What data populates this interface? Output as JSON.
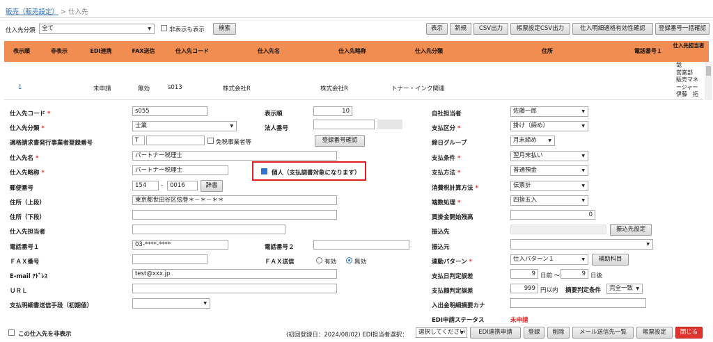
{
  "breadcrumb": {
    "link": "販売（販売設定）",
    "sep": " > ",
    "current": "仕入先"
  },
  "filter": {
    "label": "仕入先分類",
    "value": "全て",
    "show_hidden": "非表示も表示",
    "search": "検索"
  },
  "toolbar": {
    "show": "表示",
    "new": "新規",
    "csv": "CSV出力",
    "form_csv": "帳票設定CSV出力",
    "validity": "仕入明細適格有効性確認",
    "regcheck": "登録番号一括確認"
  },
  "columns": [
    "表示順",
    "非表示",
    "EDI連携",
    "FAX送信",
    "仕入先コード",
    "仕入先名",
    "仕入先略称",
    "仕入先分類",
    "住所",
    "電話番号１",
    "仕入先担当者"
  ],
  "row": {
    "order": "1",
    "edi": "未申請",
    "fax": "無効",
    "code": "s013",
    "name": "株式会社R",
    "short": "株式会社R",
    "cat": "トナー・インク関連",
    "staff": "哉\n営業部\n販売マネ\nージャー\n伊藤　拓"
  },
  "form": {
    "code_lbl": "仕入先コード",
    "code": "s055",
    "cat_lbl": "仕入先分類",
    "cat": "士業",
    "reg_lbl": "適格請求書発行事業者登録番号",
    "reg_prefix": "T",
    "exempt": "免税事業者等",
    "regbtn": "登録番号確認",
    "name_lbl": "仕入先名",
    "name": "パートナー税理士",
    "short_lbl": "仕入先略称",
    "short": "パートナー税理士",
    "personal": "個人（支払調書対象になります）",
    "zip_lbl": "郵便番号",
    "zip1": "154",
    "zip_sep": "-",
    "zip2": "0016",
    "dict": "辞書",
    "addr1_lbl": "住所（上段）",
    "addr1": "東京都世田谷区弦巻＊－＊－＊＊",
    "addr2_lbl": "住所（下段）",
    "staff_lbl": "仕入先担当者",
    "tel1_lbl": "電話番号１",
    "tel1": "03-****-****",
    "tel2_lbl": "電話番号２",
    "fax_lbl": "ＦＡＸ番号",
    "faxsend_lbl": "ＦＡＸ送信",
    "fax_on": "有効",
    "fax_off": "無効",
    "mail_lbl": "E-mail ｱﾄﾞﾚｽ",
    "mail": "test@xxx.jp",
    "url_lbl": "ＵＲＬ",
    "send_lbl": "支払明細書送信手段（初期値）",
    "order_lbl": "表示順",
    "order": "10",
    "corp_lbl": "法人番号",
    "rep_lbl": "自社担当者",
    "rep": "佐藤一郎",
    "paydiv_lbl": "支払区分",
    "paydiv": "掛け（締め）",
    "close_lbl": "締日グループ",
    "close": "月末締め",
    "cond_lbl": "支払条件",
    "cond": "翌月末払い",
    "method_lbl": "支払方法",
    "method": "普通預金",
    "tax_lbl": "消費税計算方法",
    "tax": "伝票計",
    "round_lbl": "端数処理",
    "round": "四捨五入",
    "bal_lbl": "買掛金開始残高",
    "bal": "0",
    "bank_lbl": "振込先",
    "bankbtn": "振込先設定",
    "src_lbl": "振込元",
    "pat_lbl": "連動パターン",
    "pat": "仕入パターン１",
    "aux": "補助科目",
    "day_lbl": "支払日判定誤差",
    "day1": "9",
    "day_mid": "日前 ～",
    "day2": "9",
    "day_end": "日後",
    "amt_lbl": "支払額判定誤差",
    "amt": "999",
    "amt_unit": "円以内",
    "sum_lbl": "摘要判定条件",
    "sum": "完全一致",
    "kana_lbl": "入出金明細摘要カナ",
    "edi_lbl": "EDI申請ステータス",
    "edi": "未申請"
  },
  "footer": {
    "hide": "この仕入先を非表示",
    "info": "(初回登録日：2024/08/02) EDI担当者選択：",
    "edi_sel": "選択してください",
    "edi_apply": "EDI連携申請",
    "save": "登録",
    "del": "削除",
    "mail": "メール送信先一覧",
    "form": "帳票設定",
    "close": "閉じる"
  }
}
